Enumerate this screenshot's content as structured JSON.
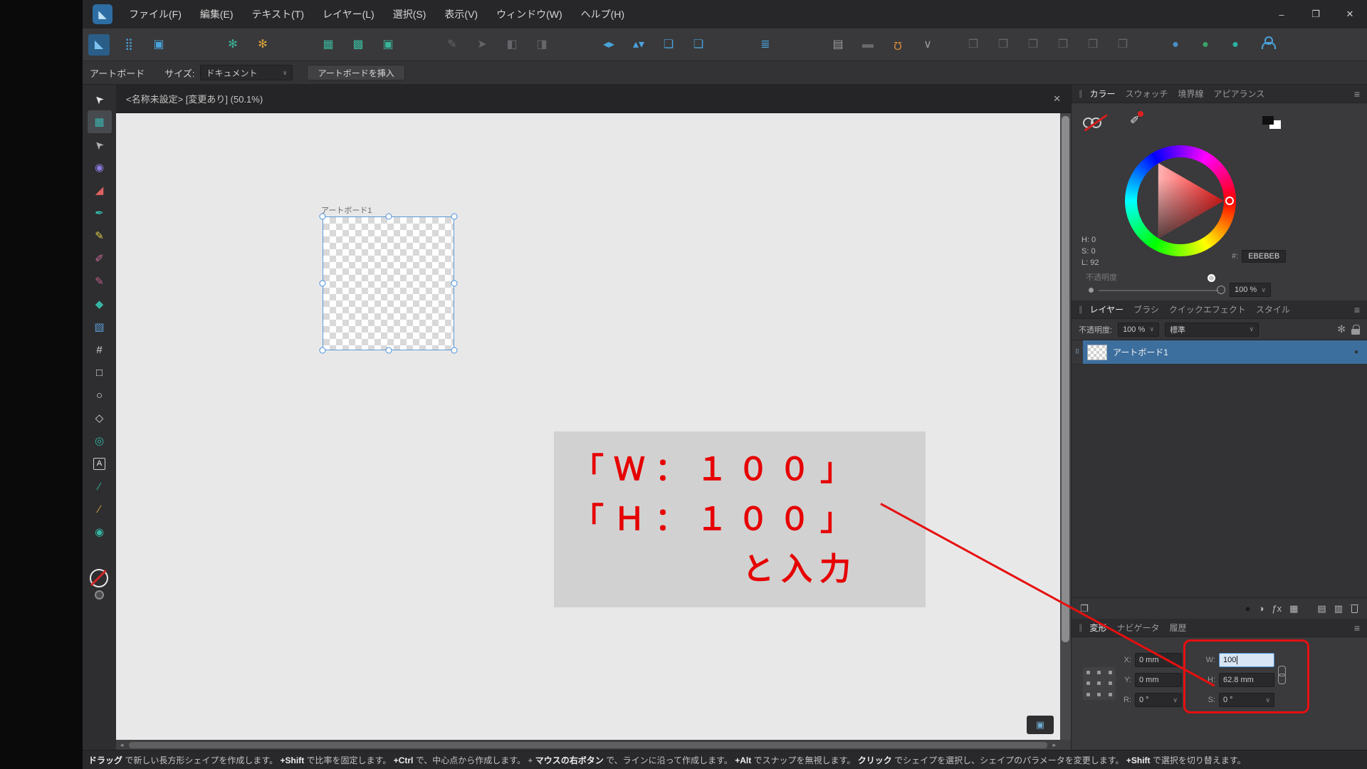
{
  "colors": {
    "accent": "#4aa3dc",
    "annotation_red": "#e61010",
    "selection": "#4a90d9",
    "layer_selected": "#3d6f9e",
    "canvas": "#e9e8e9"
  },
  "icons": {
    "app_logo": "◣",
    "chevron_down": "∨",
    "hamburger": "≡",
    "drag_handle": "∥",
    "close": "✕",
    "scroll_left": "◄",
    "scroll_right": "►",
    "layer_drag_dots": "⠿",
    "layer_visible_dot": "●",
    "corner_button": "▣",
    "gear": "✻",
    "eyedropper": "✐"
  },
  "titlebar": {
    "menus": [
      {
        "label": "ファイル(F)"
      },
      {
        "label": "編集(E)"
      },
      {
        "label": "テキスト(T)"
      },
      {
        "label": "レイヤー(L)"
      },
      {
        "label": "選択(S)"
      },
      {
        "label": "表示(V)"
      },
      {
        "label": "ウィンドウ(W)"
      },
      {
        "label": "ヘルプ(H)"
      }
    ],
    "window_controls": {
      "minimize": "–",
      "restore": "❐",
      "close": "✕"
    }
  },
  "toolbar": {
    "persona": [
      {
        "name": "designer-persona-button",
        "glyph": "◣",
        "color": "#7cc4ef",
        "row_cls": "active-tile"
      },
      {
        "name": "pixel-persona-button",
        "glyph": "⣿",
        "color": "#4aa3dc"
      },
      {
        "name": "export-persona-button",
        "glyph": "▣",
        "color": "#4aa3dc"
      }
    ],
    "gears": [
      {
        "name": "document-setup-gear-icon",
        "glyph": "✻",
        "color": "#3ab59a"
      },
      {
        "name": "preferences-gear-icon",
        "glyph": "✻",
        "color": "#d9a23a"
      }
    ],
    "snap_group": [
      {
        "name": "pixel-alignment-icon",
        "glyph": "▦",
        "color": "#3ab59a"
      },
      {
        "name": "whole-pixel-move-icon",
        "glyph": "▩",
        "color": "#3ab59a"
      },
      {
        "name": "transform-bounds-icon",
        "glyph": "▣",
        "color": "#3ab59a"
      }
    ],
    "disabled_group": [
      {
        "name": "disabled-tool-icon-1",
        "glyph": "✎",
        "color": "#66666a"
      },
      {
        "name": "disabled-tool-icon-2",
        "glyph": "➤",
        "color": "#66666a"
      },
      {
        "name": "disabled-tool-icon-3",
        "glyph": "◧",
        "color": "#66666a"
      },
      {
        "name": "disabled-tool-icon-4",
        "glyph": "◨",
        "color": "#66666a"
      }
    ],
    "arrange_group": [
      {
        "name": "flip-horizontal-icon",
        "glyph": "◂▸",
        "color": "#4aa3dc"
      },
      {
        "name": "flip-vertical-icon",
        "glyph": "▴▾",
        "color": "#4aa3dc"
      },
      {
        "name": "bring-forward-icon",
        "glyph": "❏",
        "color": "#4aa3dc"
      },
      {
        "name": "send-backward-icon",
        "glyph": "❏",
        "color": "#4aa3dc"
      }
    ],
    "align_group": [
      {
        "name": "alignment-icon",
        "glyph": "≣",
        "color": "#4aa3dc"
      }
    ],
    "snapping_group": [
      {
        "name": "snapping-presets-icon",
        "glyph": "▤",
        "color": "#9a9a9c"
      },
      {
        "name": "snapping-toggle",
        "glyph": "▬",
        "color": "#6a6a6c"
      },
      {
        "name": "snapping-magnet-icon",
        "glyph": "Ω",
        "color": "#d98a3a",
        "cls": "flip-v"
      },
      {
        "name": "snapping-chevron-icon",
        "glyph": "∨",
        "color": "#9a9a9c"
      }
    ],
    "boolean_group": [
      {
        "name": "boolean-add-icon",
        "glyph": "❒",
        "color": "#66666a"
      },
      {
        "name": "boolean-subtract-icon",
        "glyph": "❒",
        "color": "#66666a"
      },
      {
        "name": "boolean-intersect-icon",
        "glyph": "❒",
        "color": "#66666a"
      },
      {
        "name": "boolean-divide-icon",
        "glyph": "❒",
        "color": "#66666a"
      },
      {
        "name": "boolean-combine-icon",
        "glyph": "❒",
        "color": "#66666a"
      },
      {
        "name": "boolean-merge-icon",
        "glyph": "❒",
        "color": "#66666a"
      }
    ],
    "insert_group": [
      {
        "name": "insert-behind-icon",
        "glyph": "●",
        "color": "#4a90c8"
      },
      {
        "name": "insert-inside-icon",
        "glyph": "●",
        "color": "#3aa56a"
      },
      {
        "name": "insert-on-top-icon",
        "glyph": "●",
        "color": "#2bb3a3"
      }
    ]
  },
  "context_bar": {
    "artboard_label": "アートボード",
    "size_label": "サイズ:",
    "size_value": "ドキュメント",
    "insert_button": "アートボードを挿入"
  },
  "document": {
    "tab_title": "<名称未設定> [変更あり] (50.1%)",
    "artboard_name": "アートボード1"
  },
  "tools": {
    "items": [
      {
        "name": "move-tool",
        "glyph": "➤",
        "color": "#e8e8e8",
        "cls": "rot-nw"
      },
      {
        "name": "artboard-tool",
        "glyph": "▦",
        "color": "#3ab5b0",
        "row_cls": "selected"
      },
      {
        "name": "node-tool",
        "glyph": "➤",
        "color": "#b0b0b2",
        "cls": "rot-nw"
      },
      {
        "name": "contour-tool",
        "glyph": "◉",
        "color": "#8a7ae0"
      },
      {
        "name": "corner-tool",
        "glyph": "◢",
        "color": "#e06060"
      },
      {
        "name": "pen-tool",
        "glyph": "✒",
        "color": "#35b5a5"
      },
      {
        "name": "pencil-tool",
        "glyph": "✎",
        "color": "#d9c84b"
      },
      {
        "name": "vector-brush-tool",
        "glyph": "✐",
        "color": "#d06a9a"
      },
      {
        "name": "paint-brush-tool",
        "glyph": "✎",
        "color": "#c05a8a"
      },
      {
        "name": "fill-tool",
        "glyph": "◆",
        "color": "#35b5a5"
      },
      {
        "name": "transparency-tool",
        "glyph": "▧",
        "color": "#5b9bd5"
      },
      {
        "name": "crop-tool",
        "glyph": "#",
        "color": "#d9d9d9"
      },
      {
        "name": "rectangle-tool",
        "glyph": "□",
        "color": "#d9d9d9"
      },
      {
        "name": "ellipse-tool",
        "glyph": "○",
        "color": "#d9d9d9"
      },
      {
        "name": "polygon-tool",
        "glyph": "◇",
        "color": "#d9d9d9"
      },
      {
        "name": "smart-shape-tool",
        "glyph": "◎",
        "color": "#35b5a5"
      },
      {
        "name": "text-tool",
        "glyph": "A",
        "color": "#e8e8e8",
        "cls": "boxed"
      },
      {
        "name": "color-picker-tool",
        "glyph": "∕",
        "color": "#35b5a5"
      },
      {
        "name": "ruler-tool",
        "glyph": "∕",
        "color": "#d9a84b"
      },
      {
        "name": "zoom-tool",
        "glyph": "◉",
        "color": "#35b5a5"
      }
    ]
  },
  "annotation": {
    "line1": "「Ｗ：１００」",
    "line2": "「Ｈ：１００」",
    "line3": "と入力"
  },
  "color_panel": {
    "tabs": [
      {
        "label": "カラー",
        "cls": "active"
      },
      {
        "label": "スウォッチ"
      },
      {
        "label": "境界線"
      },
      {
        "label": "アピアランス"
      }
    ],
    "h": "H: 0",
    "s": "S: 0",
    "l": "L: 92",
    "hex_label": "#:",
    "hex_value": "EBEBEB",
    "opacity_label": "不透明度",
    "opacity_value": "100 %"
  },
  "layers_panel": {
    "tabs": [
      {
        "label": "レイヤー",
        "cls": "active"
      },
      {
        "label": "ブラシ"
      },
      {
        "label": "クイックエフェクト"
      },
      {
        "label": "スタイル"
      }
    ],
    "opacity_label": "不透明度:",
    "opacity_value": "100 %",
    "blend_value": "標準",
    "layer_name": "アートボード1",
    "bottom_icons_left": [
      {
        "name": "edit-all-layers-icon",
        "glyph": "❐",
        "color": "#b9b9b9"
      }
    ],
    "bottom_icons_right": [
      {
        "name": "mask-layer-icon",
        "glyph": "●",
        "color": "#18181a"
      },
      {
        "name": "adjustment-layer-icon",
        "glyph": "◑",
        "color": "#b9b9b9"
      },
      {
        "name": "layer-effects-icon",
        "glyph": "ƒx",
        "color": "#b9b9b9"
      },
      {
        "name": "fill-layer-icon",
        "glyph": "▦",
        "color": "#b9b9b9"
      },
      {
        "name": "new-layer-icon",
        "glyph": "▤",
        "color": "#b9b9b9",
        "cls": "gap-left"
      },
      {
        "name": "new-group-icon",
        "glyph": "▥",
        "color": "#b9b9b9"
      },
      {
        "name": "delete-layer-icon",
        "glyph": "",
        "color": "#b9b9b9",
        "cls": "trash"
      }
    ]
  },
  "transform_panel": {
    "tabs": [
      {
        "label": "変形",
        "cls": "active"
      },
      {
        "label": "ナビゲータ"
      },
      {
        "label": "履歴"
      }
    ],
    "x_label": "X:",
    "x_value": "0 mm",
    "y_label": "Y:",
    "y_value": "0 mm",
    "r_label": "R:",
    "r_value": "0 °",
    "w_label": "W:",
    "w_value": "100",
    "h_label": "H:",
    "h_value": "62.8 mm",
    "s_label": "S:",
    "s_value": "0 °"
  },
  "status_bar": {
    "segments": [
      {
        "text": "ドラッグ",
        "cls": "b"
      },
      {
        "text": "で新しい長方形シェイプを作成します。"
      },
      {
        "text": "+Shift",
        "cls": "b"
      },
      {
        "text": "で比率を固定します。"
      },
      {
        "text": "+Ctrl",
        "cls": "b"
      },
      {
        "text": "で、中心点から作成します。"
      },
      {
        "text": "+"
      },
      {
        "text": "マウスの右ボタン",
        "cls": "b"
      },
      {
        "text": "で、ラインに沿って作成します。"
      },
      {
        "text": "+Alt",
        "cls": "b"
      },
      {
        "text": "でスナップを無視します。"
      },
      {
        "text": "クリック",
        "cls": "b"
      },
      {
        "text": "でシェイプを選択し、シェイプのパラメータを変更します。"
      },
      {
        "text": "+Shift",
        "cls": "b"
      },
      {
        "text": "で選択を切り替えます。"
      }
    ]
  }
}
